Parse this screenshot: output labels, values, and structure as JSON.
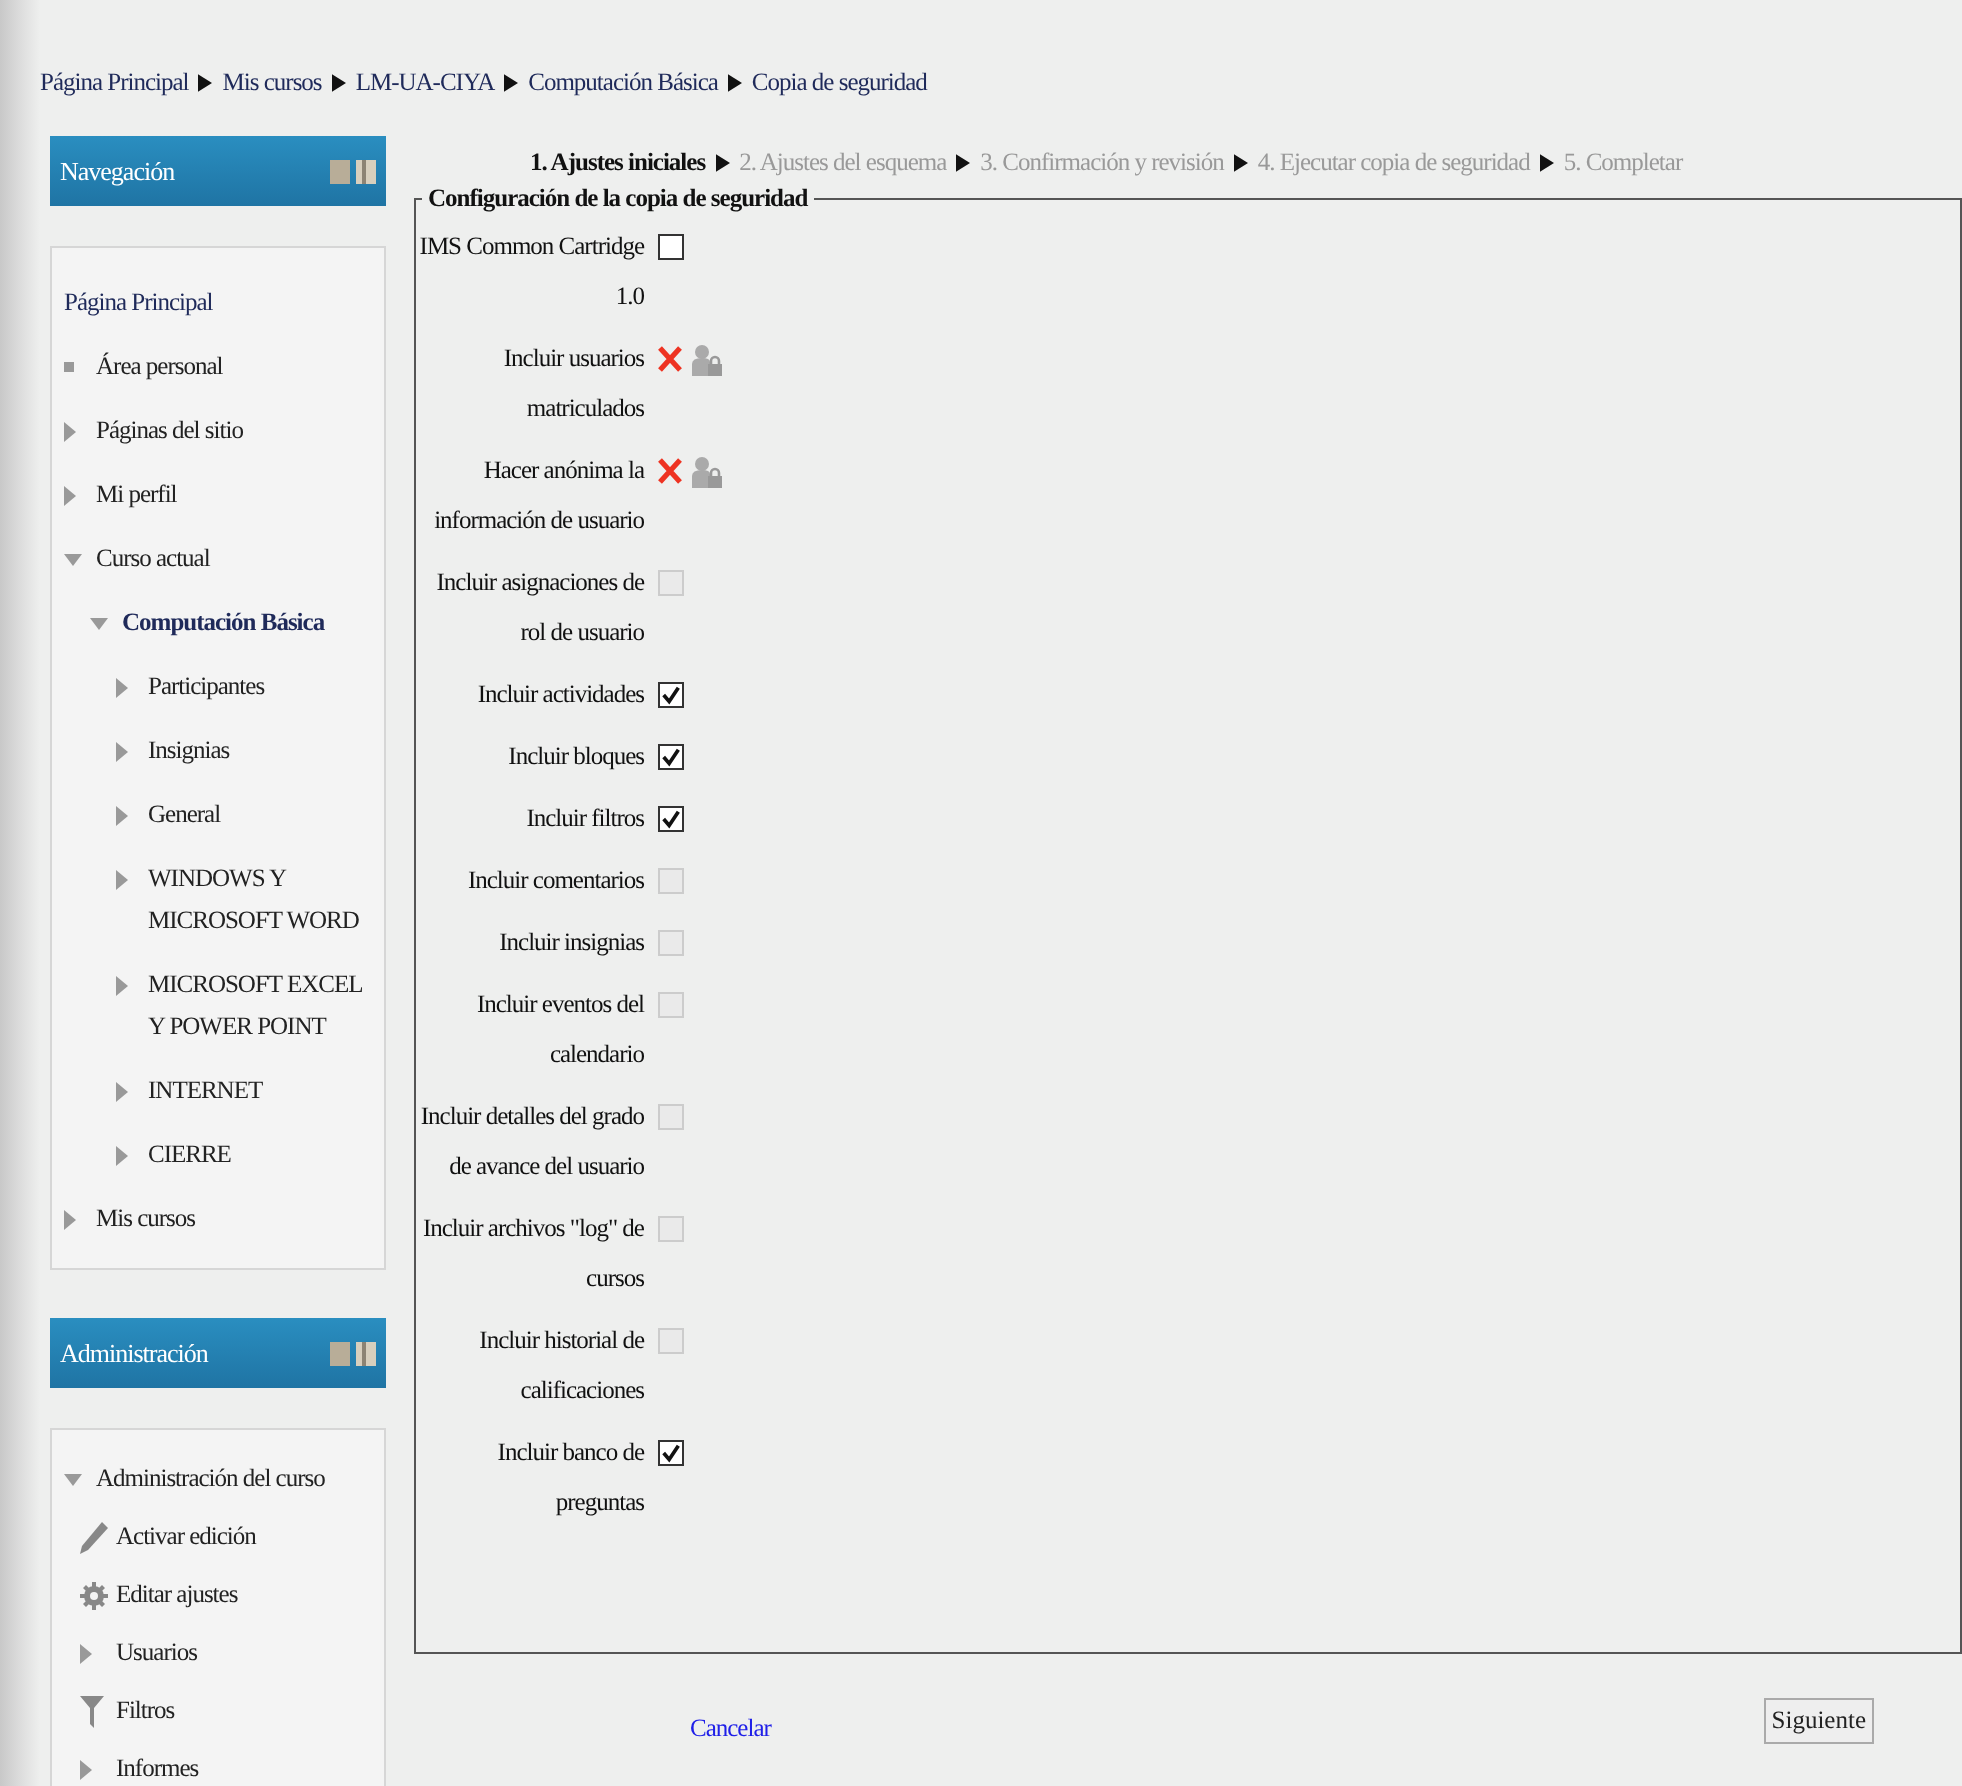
{
  "breadcrumb": [
    "Página Principal",
    "Mis cursos",
    "LM-UA-CIYA",
    "Computación Básica",
    "Copia de seguridad"
  ],
  "navigation": {
    "title": "Navegación",
    "items": [
      {
        "label": "Página Principal",
        "kind": "home"
      },
      {
        "label": "Área personal",
        "kind": "leaf"
      },
      {
        "label": "Páginas del sitio",
        "kind": "branch",
        "expanded": false
      },
      {
        "label": "Mi perfil",
        "kind": "branch",
        "expanded": false
      },
      {
        "label": "Curso actual",
        "kind": "branch",
        "expanded": true,
        "children": [
          {
            "label": "Computación Básica",
            "kind": "course",
            "expanded": true,
            "children": [
              {
                "label": "Participantes",
                "kind": "branch",
                "expanded": false
              },
              {
                "label": "Insignias",
                "kind": "branch",
                "expanded": false
              },
              {
                "label": "General",
                "kind": "branch",
                "expanded": false
              },
              {
                "label": "WINDOWS Y MICROSOFT WORD",
                "kind": "branch",
                "expanded": false
              },
              {
                "label": "MICROSOFT EXCEL Y POWER POINT",
                "kind": "branch",
                "expanded": false
              },
              {
                "label": "INTERNET",
                "kind": "branch",
                "expanded": false
              },
              {
                "label": "CIERRE",
                "kind": "branch",
                "expanded": false
              }
            ]
          }
        ]
      },
      {
        "label": "Mis cursos",
        "kind": "branch",
        "expanded": false
      }
    ]
  },
  "administration": {
    "title": "Administración",
    "items": [
      {
        "label": "Administración del curso",
        "kind": "branch",
        "expanded": true,
        "children": [
          {
            "label": "Activar edición",
            "kind": "edit"
          },
          {
            "label": "Editar ajustes",
            "kind": "settings"
          },
          {
            "label": "Usuarios",
            "kind": "branch",
            "expanded": false
          },
          {
            "label": "Filtros",
            "kind": "filter"
          },
          {
            "label": "Informes",
            "kind": "branch",
            "expanded": false
          }
        ]
      }
    ]
  },
  "steps": [
    {
      "label": "1. Ajustes iniciales",
      "selected": true
    },
    {
      "label": "2. Ajustes del esquema",
      "selected": false
    },
    {
      "label": "3. Confirmación y revisión",
      "selected": false
    },
    {
      "label": "4. Ejecutar copia de seguridad",
      "selected": false
    },
    {
      "label": "5. Completar",
      "selected": false
    }
  ],
  "form": {
    "legend": "Configuración de la copia de seguridad",
    "settings": [
      {
        "label": "IMS Common Cartridge 1.0",
        "kind": "checkbox",
        "checked": false,
        "disabled": false
      },
      {
        "label": "Incluir usuarios matriculados",
        "kind": "locked"
      },
      {
        "label": "Hacer anónima la información de usuario",
        "kind": "locked"
      },
      {
        "label": "Incluir asignaciones de rol de usuario",
        "kind": "checkbox",
        "checked": false,
        "disabled": true
      },
      {
        "label": "Incluir actividades",
        "kind": "checkbox",
        "checked": true,
        "disabled": false
      },
      {
        "label": "Incluir bloques",
        "kind": "checkbox",
        "checked": true,
        "disabled": false
      },
      {
        "label": "Incluir filtros",
        "kind": "checkbox",
        "checked": true,
        "disabled": false
      },
      {
        "label": "Incluir comentarios",
        "kind": "checkbox",
        "checked": false,
        "disabled": true
      },
      {
        "label": "Incluir insignias",
        "kind": "checkbox",
        "checked": false,
        "disabled": true
      },
      {
        "label": "Incluir eventos del calendario",
        "kind": "checkbox",
        "checked": false,
        "disabled": true
      },
      {
        "label": "Incluir detalles del grado de avance del usuario",
        "kind": "checkbox",
        "checked": false,
        "disabled": true
      },
      {
        "label": "Incluir archivos \"log\" de cursos",
        "kind": "checkbox",
        "checked": false,
        "disabled": true
      },
      {
        "label": "Incluir historial de calificaciones",
        "kind": "checkbox",
        "checked": false,
        "disabled": true
      },
      {
        "label": "Incluir banco de preguntas",
        "kind": "checkbox",
        "checked": true,
        "disabled": false
      }
    ]
  },
  "buttons": {
    "cancel": "Cancelar",
    "next": "Siguiente"
  }
}
